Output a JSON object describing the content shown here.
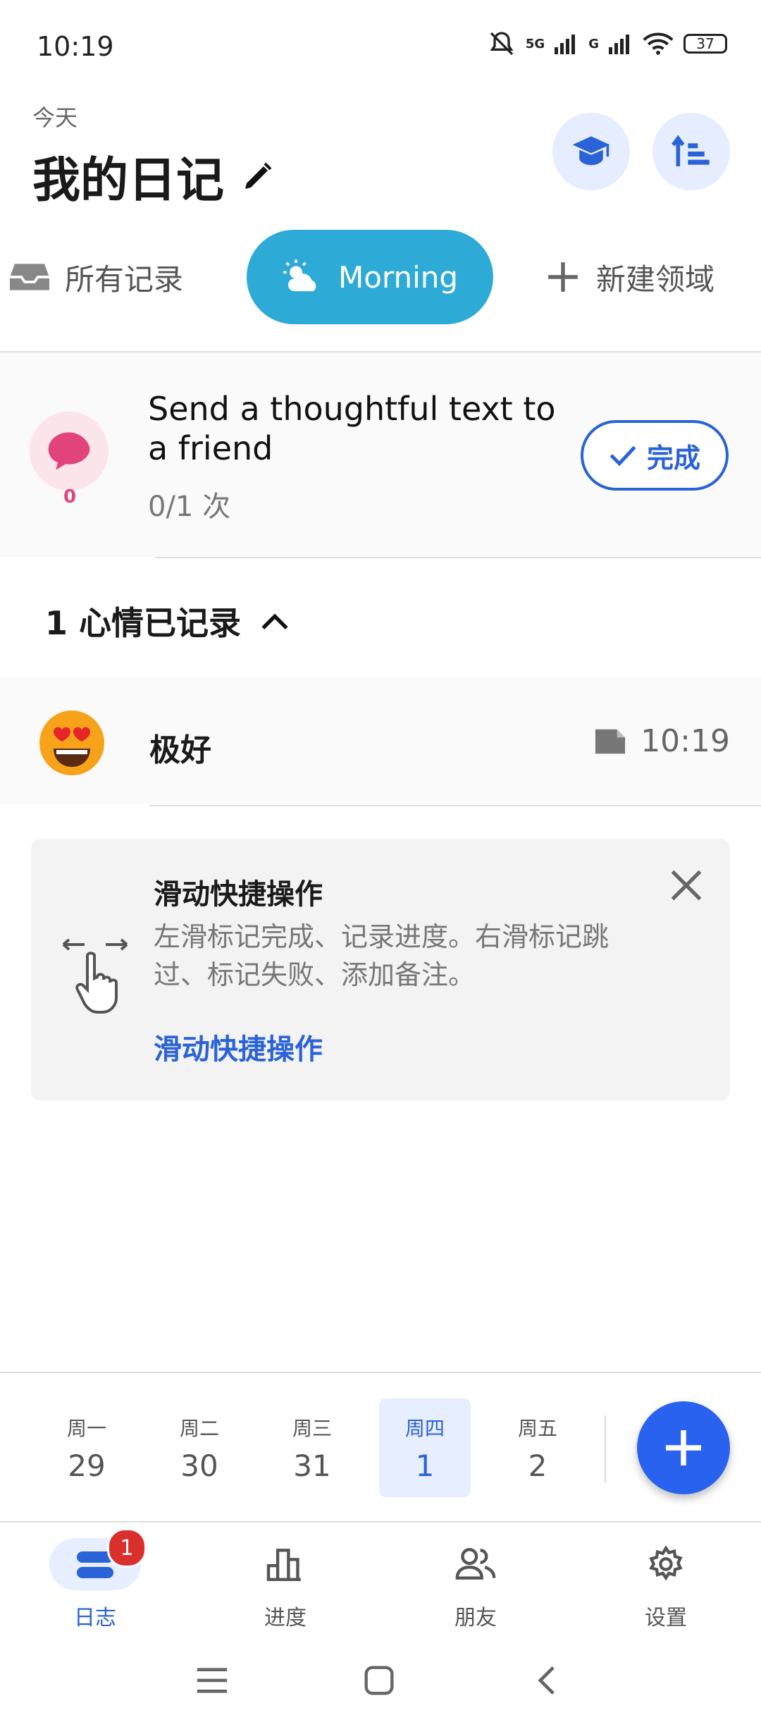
{
  "status_bar": {
    "time": "10:19",
    "network_1": "5G",
    "network_2": "G",
    "battery": "37",
    "icons": [
      "bell-muted-icon",
      "signal-icon",
      "signal-icon",
      "wifi-icon",
      "battery-icon"
    ]
  },
  "header": {
    "date_label": "今天",
    "title": "我的日记",
    "edit_icon": "pencil-icon",
    "actions": [
      "graduation-cap-icon",
      "sort-icon"
    ]
  },
  "tabs": [
    {
      "label": "所有记录",
      "icon": "inbox-icon",
      "active": false
    },
    {
      "label": "Morning",
      "icon": "partly-sunny-icon",
      "active": true
    },
    {
      "label": "新建领域",
      "icon": "plus-icon",
      "active": false
    }
  ],
  "task": {
    "title": "Send a thoughtful text to a friend",
    "progress": "0/1 次",
    "count": "0",
    "done_label": "完成",
    "icon": "chat-bubble-icon",
    "accent": "#e0447a"
  },
  "mood": {
    "header": "1 心情已记录",
    "entry_label": "极好",
    "entry_time": "10:19",
    "emoji": "heart-eyes-emoji-icon",
    "note_icon": "note-icon"
  },
  "tip": {
    "title": "滑动快捷操作",
    "body": "左滑标记完成、记录进度。右滑标记跳过、标记失败、添加备注。",
    "link": "滑动快捷操作",
    "icon": "swipe-hand-icon"
  },
  "week": {
    "days": [
      {
        "name": "周一",
        "date": "29",
        "active": false
      },
      {
        "name": "周二",
        "date": "30",
        "active": false
      },
      {
        "name": "周三",
        "date": "31",
        "active": false
      },
      {
        "name": "周四",
        "date": "1",
        "active": true
      },
      {
        "name": "周五",
        "date": "2",
        "active": false
      }
    ]
  },
  "bottom_nav": [
    {
      "label": "日志",
      "icon": "journal-icon",
      "active": true,
      "badge": "1"
    },
    {
      "label": "进度",
      "icon": "bar-chart-icon",
      "active": false
    },
    {
      "label": "朋友",
      "icon": "friends-icon",
      "active": false
    },
    {
      "label": "设置",
      "icon": "gear-icon",
      "active": false
    }
  ],
  "colors": {
    "accent": "#2a62d8",
    "tab_active": "#2eaad6",
    "fab": "#2a62f0",
    "badge": "#d9302e"
  }
}
